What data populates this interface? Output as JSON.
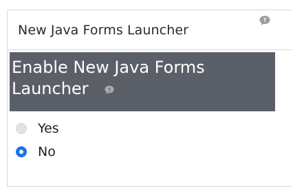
{
  "panel": {
    "title": "New Java Forms Launcher",
    "help_icon": "speech-bubble-help-icon"
  },
  "section": {
    "title": "Enable New Java Forms Launcher",
    "help_icon": "speech-bubble-help-icon"
  },
  "options": [
    {
      "label": "Yes",
      "selected": false
    },
    {
      "label": "No",
      "selected": true
    }
  ],
  "colors": {
    "section_background": "#5b6068",
    "radio_selected": "#1a73e8",
    "radio_unselected": "#e1e3e6",
    "help_icon": "#9a9ea3"
  }
}
